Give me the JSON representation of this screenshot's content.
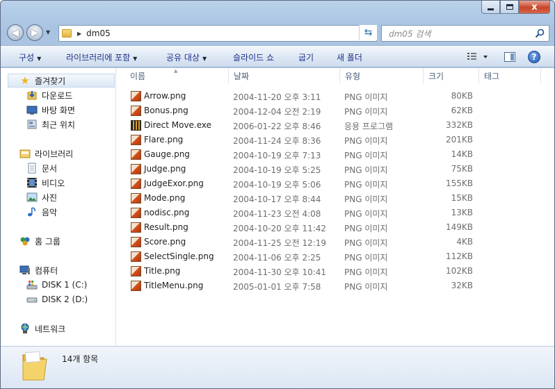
{
  "window": {
    "caption_close": "x"
  },
  "address": {
    "crumb": "dm05",
    "search_placeholder": "dm05 검색"
  },
  "toolbar": {
    "organize": "구성",
    "include_library": "라이브러리에 포함",
    "share": "공유 대상",
    "slideshow": "슬라이드 쇼",
    "burn": "굽기",
    "new_folder": "새 폴더"
  },
  "sidebar": {
    "favorites": "즐겨찾기",
    "downloads": "다운로드",
    "desktop": "바탕 화면",
    "recent": "최근 위치",
    "libraries": "라이브러리",
    "documents": "문서",
    "videos": "비디오",
    "pictures": "사진",
    "music": "음악",
    "homegroup": "홈 그룹",
    "computer": "컴퓨터",
    "disk1": "DISK 1 (C:)",
    "disk2": "DISK 2 (D:)",
    "network": "네트워크"
  },
  "columns": {
    "name": "이름",
    "date": "날짜",
    "type": "유형",
    "size": "크기",
    "tags": "태그"
  },
  "files": [
    {
      "name": "Arrow.png",
      "date": "2004-11-20 오후 3:11",
      "type": "PNG 이미지",
      "size": "80KB",
      "icon": "png-image-icon"
    },
    {
      "name": "Bonus.png",
      "date": "2004-12-04 오전 2:19",
      "type": "PNG 이미지",
      "size": "62KB",
      "icon": "png-image-icon"
    },
    {
      "name": "Direct Move.exe",
      "date": "2006-01-22 오후 8:46",
      "type": "응용 프로그램",
      "size": "332KB",
      "icon": "application-icon"
    },
    {
      "name": "Flare.png",
      "date": "2004-11-24 오후 8:36",
      "type": "PNG 이미지",
      "size": "201KB",
      "icon": "png-image-icon"
    },
    {
      "name": "Gauge.png",
      "date": "2004-10-19 오후 7:13",
      "type": "PNG 이미지",
      "size": "14KB",
      "icon": "png-image-icon"
    },
    {
      "name": "Judge.png",
      "date": "2004-10-19 오후 5:25",
      "type": "PNG 이미지",
      "size": "75KB",
      "icon": "png-image-icon"
    },
    {
      "name": "JudgeExor.png",
      "date": "2004-10-19 오후 5:06",
      "type": "PNG 이미지",
      "size": "155KB",
      "icon": "png-image-icon"
    },
    {
      "name": "Mode.png",
      "date": "2004-10-17 오후 8:44",
      "type": "PNG 이미지",
      "size": "15KB",
      "icon": "png-image-icon"
    },
    {
      "name": "nodisc.png",
      "date": "2004-11-23 오전 4:08",
      "type": "PNG 이미지",
      "size": "13KB",
      "icon": "png-image-icon"
    },
    {
      "name": "Result.png",
      "date": "2004-10-20 오후 11:42",
      "type": "PNG 이미지",
      "size": "149KB",
      "icon": "png-image-icon"
    },
    {
      "name": "Score.png",
      "date": "2004-11-25 오전 12:19",
      "type": "PNG 이미지",
      "size": "4KB",
      "icon": "png-image-icon"
    },
    {
      "name": "SelectSingle.png",
      "date": "2004-11-06 오후 2:25",
      "type": "PNG 이미지",
      "size": "112KB",
      "icon": "png-image-icon"
    },
    {
      "name": "Title.png",
      "date": "2004-11-30 오후 10:41",
      "type": "PNG 이미지",
      "size": "102KB",
      "icon": "png-image-icon"
    },
    {
      "name": "TitleMenu.png",
      "date": "2005-01-01 오후 7:58",
      "type": "PNG 이미지",
      "size": "32KB",
      "icon": "png-image-icon"
    }
  ],
  "status": {
    "count": "14개 항목"
  }
}
